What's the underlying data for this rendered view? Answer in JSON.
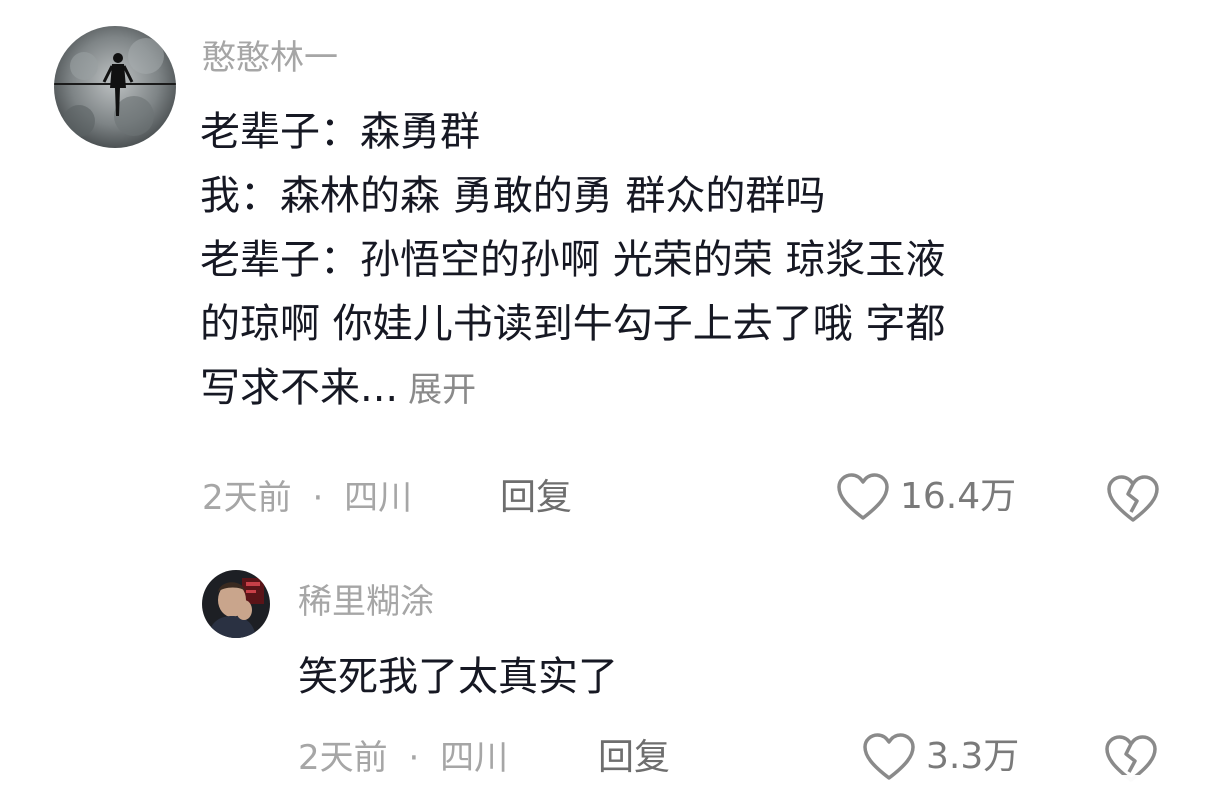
{
  "comments": [
    {
      "username": "憨憨林一",
      "text_lines": [
        "老辈子：森勇群",
        "我：森林的森 勇敢的勇 群众的群吗",
        "老辈子：孙悟空的孙啊 光荣的荣  琼浆玉液",
        "的琼啊 你娃儿书读到牛勾子上去了哦 字都",
        "写求不来..."
      ],
      "expand_label": "展开",
      "time": "2天前",
      "separator": "·",
      "location": "四川",
      "reply_label": "回复",
      "like_icon": "heart-outline-icon",
      "like_count": "16.4万",
      "dislike_icon": "broken-heart-icon"
    },
    {
      "username": "稀里糊涂",
      "text_lines": [
        "笑死我了太真实了"
      ],
      "time": "2天前",
      "separator": "·",
      "location": "四川",
      "reply_label": "回复",
      "like_icon": "heart-outline-icon",
      "like_count": "3.3万",
      "dislike_icon": "broken-heart-icon"
    }
  ],
  "colors": {
    "username": "#a6a6a6",
    "text": "#161823",
    "meta": "#a6a6a6",
    "icon": "#8a8a8a"
  }
}
